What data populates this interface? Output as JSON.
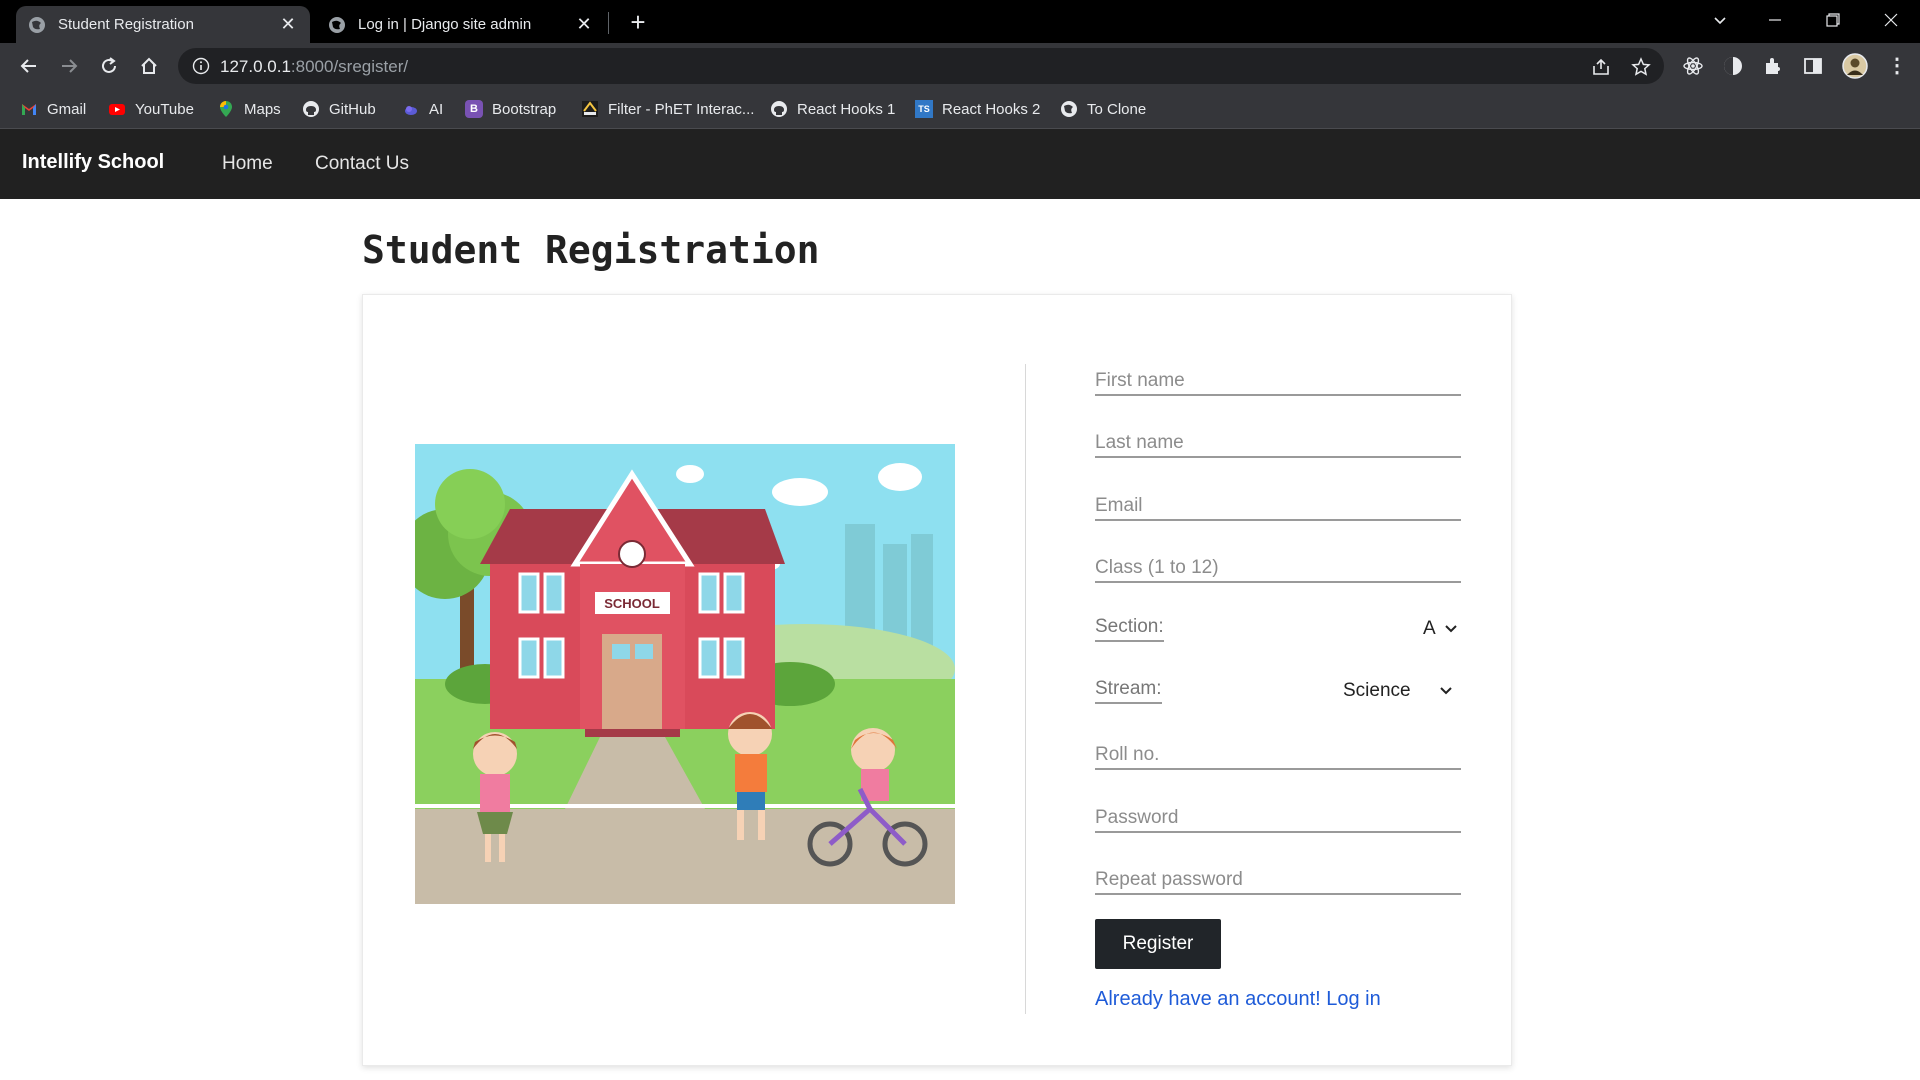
{
  "browser": {
    "tabs": [
      {
        "title": "Student Registration",
        "active": true
      },
      {
        "title": "Log in | Django site admin",
        "active": false
      }
    ],
    "url_host": "127.0.0.1",
    "url_path": ":8000/sregister/",
    "bookmarks": [
      {
        "label": "Gmail",
        "icon": "gmail-icon"
      },
      {
        "label": "YouTube",
        "icon": "youtube-icon"
      },
      {
        "label": "Maps",
        "icon": "maps-icon"
      },
      {
        "label": "GitHub",
        "icon": "github-icon"
      },
      {
        "label": "AI",
        "icon": "ai-icon"
      },
      {
        "label": "Bootstrap",
        "icon": "bootstrap-icon"
      },
      {
        "label": "Filter - PhET Interac...",
        "icon": "phet-icon"
      },
      {
        "label": "React Hooks 1",
        "icon": "github-icon"
      },
      {
        "label": "React Hooks 2",
        "icon": "typescript-icon"
      },
      {
        "label": "To Clone",
        "icon": "globe-icon"
      }
    ]
  },
  "site": {
    "brand": "Intellify School",
    "nav": [
      "Home",
      "Contact Us"
    ]
  },
  "page": {
    "title": "Student Registration"
  },
  "form": {
    "first_name": "First name",
    "last_name": "Last name",
    "email": "Email",
    "class": "Class (1 to 12)",
    "section_label": "Section:",
    "section_value": "A",
    "stream_label": "Stream:",
    "stream_value": "Science",
    "roll_no": "Roll no.",
    "password": "Password",
    "repeat_password": "Repeat password",
    "register": "Register",
    "login_link": "Already have an account! Log in"
  },
  "illustration": {
    "sign": "SCHOOL"
  },
  "colors": {
    "navbar": "#212121",
    "button": "#212529",
    "link": "#1e5bd8"
  }
}
